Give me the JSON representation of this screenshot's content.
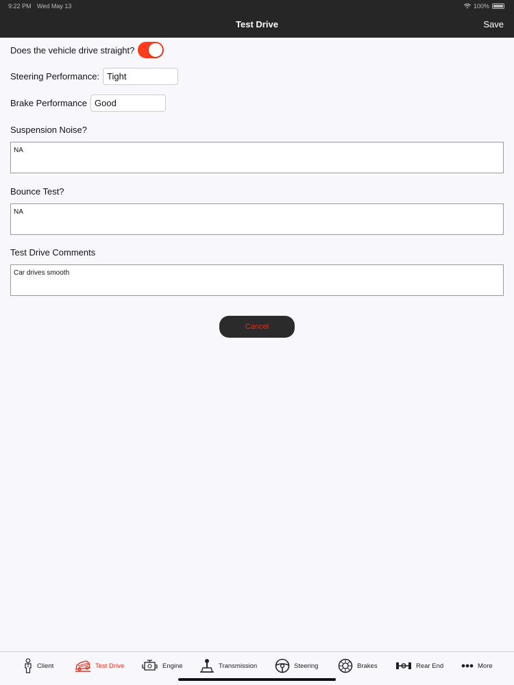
{
  "status_bar": {
    "time": "9:22 PM",
    "date": "Wed May 13",
    "battery": "100%"
  },
  "nav": {
    "title": "Test Drive",
    "save_label": "Save"
  },
  "form": {
    "drive_straight": {
      "label": "Does the vehicle drive straight?",
      "value": true
    },
    "steering": {
      "label": "Steering Performance:",
      "value": "Tight"
    },
    "brake": {
      "label": "Brake Performance",
      "value": "Good"
    },
    "suspension": {
      "label": "Suspension Noise?",
      "value": "NA"
    },
    "bounce": {
      "label": "Bounce Test?",
      "value": "NA"
    },
    "comments": {
      "label": "Test Drive Comments",
      "value": "Car drives smooth"
    },
    "cancel_label": "Cancel"
  },
  "tabs": [
    {
      "label": "Client",
      "icon": "person-icon"
    },
    {
      "label": "Test Drive",
      "icon": "car-icon",
      "active": true
    },
    {
      "label": "Engine",
      "icon": "engine-icon"
    },
    {
      "label": "Transmission",
      "icon": "gear-shifter-icon"
    },
    {
      "label": "Steering",
      "icon": "steering-wheel-icon"
    },
    {
      "label": "Brakes",
      "icon": "brake-disc-icon"
    },
    {
      "label": "Rear End",
      "icon": "axle-icon"
    },
    {
      "label": "More",
      "icon": "more-icon"
    }
  ],
  "colors": {
    "accent": "#e2311d",
    "toggle_on": "#ff3b1e",
    "nav_bg": "#262626"
  }
}
